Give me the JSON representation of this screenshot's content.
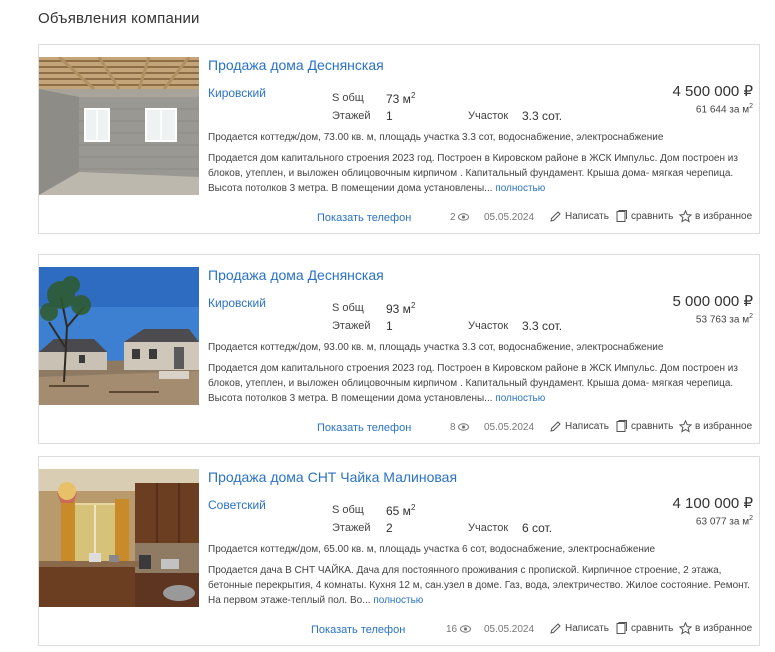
{
  "page_title": "Объявления компании",
  "listings": [
    {
      "title": "Продажа дома Деснянская",
      "district": "Кировский",
      "area_label": "S общ",
      "area_value": "73 м",
      "area_sup": "2",
      "floors_label": "Этажей",
      "floors_value": "1",
      "plot_label": "Участок",
      "plot_value": "3.3 сот.",
      "price": "4 500 000 ₽",
      "price_per_m": "61 644 за м",
      "price_per_m_sup": "2",
      "summary": "Продается коттедж/дом, 73.00 кв. м, площадь участка 3.3 сот, водоснабжение, электроснабжение",
      "description": "Продается дом капитального строения 2023 год. Построен в Кировском районе в ЖСК Импульс. Дом построен из блоков, утеплен, и выложен облицовочным кирпичом . Капитальный фундамент. Крыша дома- мягкая черепица. Высота потолков 3 метра. В помещении дома установлены...",
      "more_label": "полностью",
      "phone_label": "Показать телефон",
      "views": "2",
      "date": "05.05.2024",
      "write_label": "Написать",
      "compare_label": "сравнить",
      "favorite_label": "в избранное"
    },
    {
      "title": "Продажа дома Деснянская",
      "district": "Кировский",
      "area_label": "S общ",
      "area_value": "93 м",
      "area_sup": "2",
      "floors_label": "Этажей",
      "floors_value": "1",
      "plot_label": "Участок",
      "plot_value": "3.3 сот.",
      "price": "5 000 000 ₽",
      "price_per_m": "53 763 за м",
      "price_per_m_sup": "2",
      "summary": "Продается коттедж/дом, 93.00 кв. м, площадь участка 3.3 сот, водоснабжение, электроснабжение",
      "description": "Продается дом капитального строения 2023 год. Построен в Кировском районе в ЖСК Импульс. Дом построен из блоков, утеплен, и выложен облицовочным кирпичом . Капитальный фундамент. Крыша дома- мягкая черепица. Высота потолков 3 метра. В помещении дома установлены...",
      "more_label": "полностью",
      "phone_label": "Показать телефон",
      "views": "8",
      "date": "05.05.2024",
      "write_label": "Написать",
      "compare_label": "сравнить",
      "favorite_label": "в избранное"
    },
    {
      "title": "Продажа дома СНТ Чайка Малиновая",
      "district": "Советский",
      "area_label": "S общ",
      "area_value": "65 м",
      "area_sup": "2",
      "floors_label": "Этажей",
      "floors_value": "2",
      "plot_label": "Участок",
      "plot_value": "6 сот.",
      "price": "4 100 000 ₽",
      "price_per_m": "63 077 за м",
      "price_per_m_sup": "2",
      "summary": "Продается коттедж/дом, 65.00 кв. м, площадь участка 6 сот, водоснабжение, электроснабжение",
      "description": "Продается дача В СНТ ЧАЙКА. Дача для постоянного проживания с пропиской. Кирпичное строение, 2 этажа, бетонные перекрытия, 4 комнаты. Кухня 12 м, сан.узел в доме. Газ, вода, электричество. Жилое состояние. Ремонт. На первом этаже-теплый пол. Во...",
      "more_label": "полностью",
      "phone_label": "Показать телефон",
      "views": "16",
      "date": "05.05.2024",
      "write_label": "Написать",
      "compare_label": "сравнить",
      "favorite_label": "в избранное"
    }
  ]
}
